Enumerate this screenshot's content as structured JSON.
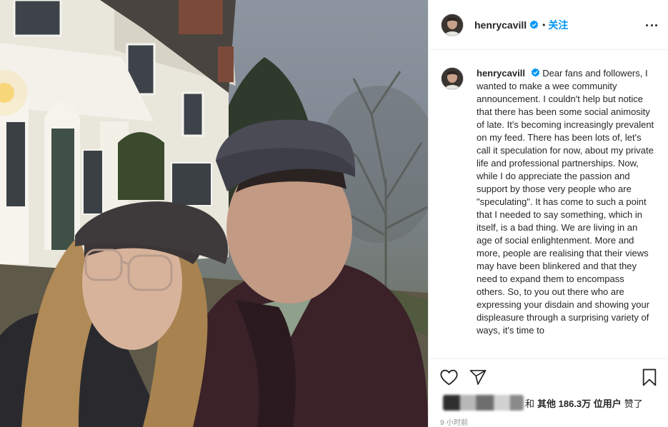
{
  "post": {
    "image_alt": "Selfie of Henry Cavill and a woman wearing flat caps in front of a white house"
  },
  "header": {
    "username": "henrycavill",
    "verified_icon": "verified-badge-icon",
    "separator": "•",
    "follow_label": "关注",
    "more_icon": "more-options-icon"
  },
  "caption": {
    "username": "henrycavill",
    "text": "Dear fans and followers, I wanted to make a wee community announcement. I couldn't help but notice that there has been some social animosity of late. It's becoming increasingly prevalent on my feed. There has been lots of, let's call it speculation for now, about my private life and professional partnerships. Now, while I do appreciate the passion and support by those very people who are \"speculating\". It has come to such a point that I needed to say something, which in itself, is a bad thing. We are living in an age of social enlightenment. More and more, people are realising that their views may have been blinkered and that they need to expand them to encompass others. So, to you out there who are expressing your disdain and showing your displeasure through a surprising variety of ways, it's time to"
  },
  "actions": {
    "like_icon": "heart-icon",
    "share_icon": "paper-plane-icon",
    "save_icon": "bookmark-icon"
  },
  "likes": {
    "prefix": "和",
    "others": "其他 186.3万 位用户",
    "suffix": "赞了"
  },
  "timestamp": "9 小时前",
  "colors": {
    "accent": "#0095f6",
    "text": "#262626",
    "muted": "#8e8e8e",
    "border": "#efefef"
  }
}
